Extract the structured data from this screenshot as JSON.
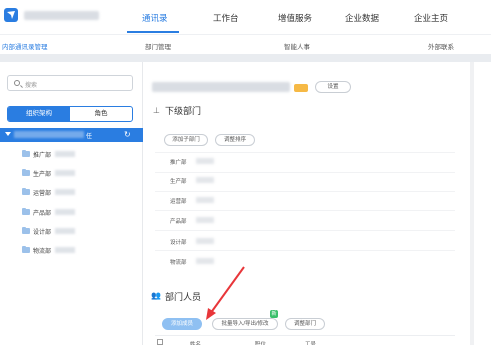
{
  "topnav": {
    "items": [
      "通讯录",
      "工作台",
      "增值服务",
      "企业数据",
      "企业主页"
    ],
    "active_index": 0
  },
  "subnav": {
    "left_link": "内部通讯录管理",
    "items": [
      "部门管理",
      "智能人事",
      "外部联系"
    ]
  },
  "sidebar": {
    "search_placeholder": "搜索",
    "tabs": [
      "组织架构",
      "角色"
    ],
    "root_suffix": "任",
    "departments": [
      "推广部",
      "生产部",
      "运营部",
      "产品部",
      "设计部",
      "物流部"
    ]
  },
  "main": {
    "settings_button": "设置",
    "sub_depts_title": "下级部门",
    "add_subdept_button": "添加子部门",
    "reorder_button": "调整排序",
    "dept_list": [
      "推广部",
      "生产部",
      "运营部",
      "产品部",
      "设计部",
      "物流部"
    ],
    "members_title": "部门人员",
    "add_member_button": "添加成员",
    "bulk_button": "批量导入/导出/修改",
    "adjust_dept_button": "调整部门",
    "badge_text": "新",
    "table_headers": [
      "姓名",
      "职位",
      "工号"
    ]
  },
  "colors": {
    "accent": "#2a7de1",
    "tag": "#f6b945",
    "annotation_arrow": "#e8363a",
    "badge": "#3bbf6b"
  }
}
